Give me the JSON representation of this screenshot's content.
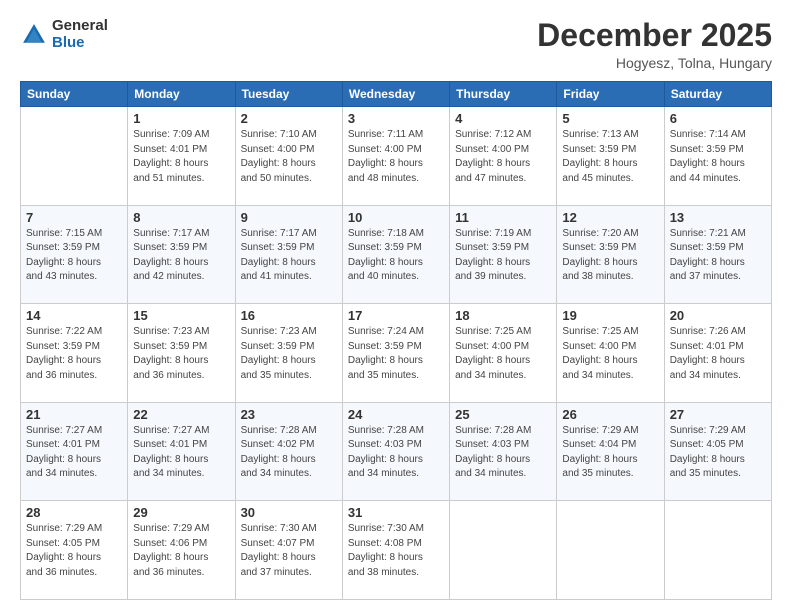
{
  "logo": {
    "general": "General",
    "blue": "Blue"
  },
  "header": {
    "month": "December 2025",
    "location": "Hogyesz, Tolna, Hungary"
  },
  "weekdays": [
    "Sunday",
    "Monday",
    "Tuesday",
    "Wednesday",
    "Thursday",
    "Friday",
    "Saturday"
  ],
  "weeks": [
    [
      {
        "day": "",
        "info": ""
      },
      {
        "day": "1",
        "info": "Sunrise: 7:09 AM\nSunset: 4:01 PM\nDaylight: 8 hours\nand 51 minutes."
      },
      {
        "day": "2",
        "info": "Sunrise: 7:10 AM\nSunset: 4:00 PM\nDaylight: 8 hours\nand 50 minutes."
      },
      {
        "day": "3",
        "info": "Sunrise: 7:11 AM\nSunset: 4:00 PM\nDaylight: 8 hours\nand 48 minutes."
      },
      {
        "day": "4",
        "info": "Sunrise: 7:12 AM\nSunset: 4:00 PM\nDaylight: 8 hours\nand 47 minutes."
      },
      {
        "day": "5",
        "info": "Sunrise: 7:13 AM\nSunset: 3:59 PM\nDaylight: 8 hours\nand 45 minutes."
      },
      {
        "day": "6",
        "info": "Sunrise: 7:14 AM\nSunset: 3:59 PM\nDaylight: 8 hours\nand 44 minutes."
      }
    ],
    [
      {
        "day": "7",
        "info": "Sunrise: 7:15 AM\nSunset: 3:59 PM\nDaylight: 8 hours\nand 43 minutes."
      },
      {
        "day": "8",
        "info": "Sunrise: 7:17 AM\nSunset: 3:59 PM\nDaylight: 8 hours\nand 42 minutes."
      },
      {
        "day": "9",
        "info": "Sunrise: 7:17 AM\nSunset: 3:59 PM\nDaylight: 8 hours\nand 41 minutes."
      },
      {
        "day": "10",
        "info": "Sunrise: 7:18 AM\nSunset: 3:59 PM\nDaylight: 8 hours\nand 40 minutes."
      },
      {
        "day": "11",
        "info": "Sunrise: 7:19 AM\nSunset: 3:59 PM\nDaylight: 8 hours\nand 39 minutes."
      },
      {
        "day": "12",
        "info": "Sunrise: 7:20 AM\nSunset: 3:59 PM\nDaylight: 8 hours\nand 38 minutes."
      },
      {
        "day": "13",
        "info": "Sunrise: 7:21 AM\nSunset: 3:59 PM\nDaylight: 8 hours\nand 37 minutes."
      }
    ],
    [
      {
        "day": "14",
        "info": "Sunrise: 7:22 AM\nSunset: 3:59 PM\nDaylight: 8 hours\nand 36 minutes."
      },
      {
        "day": "15",
        "info": "Sunrise: 7:23 AM\nSunset: 3:59 PM\nDaylight: 8 hours\nand 36 minutes."
      },
      {
        "day": "16",
        "info": "Sunrise: 7:23 AM\nSunset: 3:59 PM\nDaylight: 8 hours\nand 35 minutes."
      },
      {
        "day": "17",
        "info": "Sunrise: 7:24 AM\nSunset: 3:59 PM\nDaylight: 8 hours\nand 35 minutes."
      },
      {
        "day": "18",
        "info": "Sunrise: 7:25 AM\nSunset: 4:00 PM\nDaylight: 8 hours\nand 34 minutes."
      },
      {
        "day": "19",
        "info": "Sunrise: 7:25 AM\nSunset: 4:00 PM\nDaylight: 8 hours\nand 34 minutes."
      },
      {
        "day": "20",
        "info": "Sunrise: 7:26 AM\nSunset: 4:01 PM\nDaylight: 8 hours\nand 34 minutes."
      }
    ],
    [
      {
        "day": "21",
        "info": "Sunrise: 7:27 AM\nSunset: 4:01 PM\nDaylight: 8 hours\nand 34 minutes."
      },
      {
        "day": "22",
        "info": "Sunrise: 7:27 AM\nSunset: 4:01 PM\nDaylight: 8 hours\nand 34 minutes."
      },
      {
        "day": "23",
        "info": "Sunrise: 7:28 AM\nSunset: 4:02 PM\nDaylight: 8 hours\nand 34 minutes."
      },
      {
        "day": "24",
        "info": "Sunrise: 7:28 AM\nSunset: 4:03 PM\nDaylight: 8 hours\nand 34 minutes."
      },
      {
        "day": "25",
        "info": "Sunrise: 7:28 AM\nSunset: 4:03 PM\nDaylight: 8 hours\nand 34 minutes."
      },
      {
        "day": "26",
        "info": "Sunrise: 7:29 AM\nSunset: 4:04 PM\nDaylight: 8 hours\nand 35 minutes."
      },
      {
        "day": "27",
        "info": "Sunrise: 7:29 AM\nSunset: 4:05 PM\nDaylight: 8 hours\nand 35 minutes."
      }
    ],
    [
      {
        "day": "28",
        "info": "Sunrise: 7:29 AM\nSunset: 4:05 PM\nDaylight: 8 hours\nand 36 minutes."
      },
      {
        "day": "29",
        "info": "Sunrise: 7:29 AM\nSunset: 4:06 PM\nDaylight: 8 hours\nand 36 minutes."
      },
      {
        "day": "30",
        "info": "Sunrise: 7:30 AM\nSunset: 4:07 PM\nDaylight: 8 hours\nand 37 minutes."
      },
      {
        "day": "31",
        "info": "Sunrise: 7:30 AM\nSunset: 4:08 PM\nDaylight: 8 hours\nand 38 minutes."
      },
      {
        "day": "",
        "info": ""
      },
      {
        "day": "",
        "info": ""
      },
      {
        "day": "",
        "info": ""
      }
    ]
  ]
}
